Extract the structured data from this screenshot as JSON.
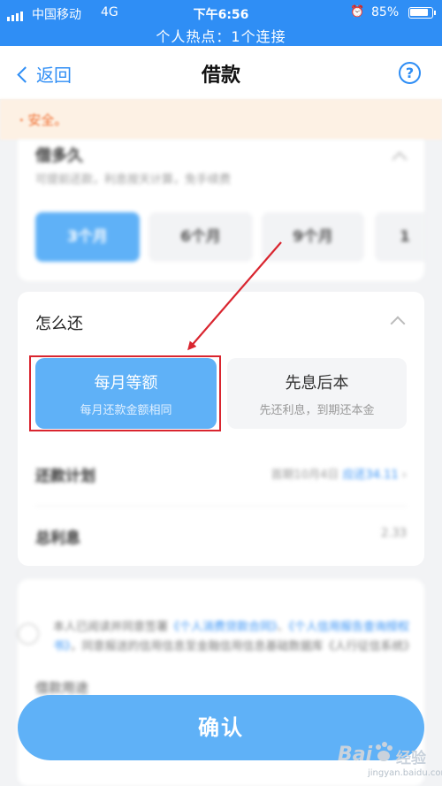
{
  "status_bar": {
    "carrier": "中国移动",
    "network": "4G",
    "time": "下午6:56",
    "battery": "85%",
    "hotspot": "个人热点：1个连接"
  },
  "nav": {
    "back_label": "返回",
    "title": "借款",
    "help_label": "?"
  },
  "notice": {
    "text": "ꞏ 安全。"
  },
  "loan_term": {
    "title": "借多久",
    "subtitle": "可提前还款，利息按天计算，免手续费",
    "options": [
      "3个月",
      "6个月",
      "9个月",
      "1"
    ],
    "selected_index": 0
  },
  "repayment": {
    "title": "怎么还",
    "options": [
      {
        "title": "每月等额",
        "subtitle": "每月还款金额相同"
      },
      {
        "title": "先息后本",
        "subtitle": "先还利息，到期还本金"
      }
    ],
    "selected_index": 0,
    "plan_label": "还款计划",
    "plan_value_prefix": "首期10月4日",
    "plan_value_amount": "应还34.11",
    "interest_label": "总利息",
    "interest_value": "2.33"
  },
  "agreement": {
    "prefix": "本人已阅读并同意签署",
    "link1": "《个人消费贷款合同》",
    "sep": "、",
    "link2": "《个人信用报告查询授权书》",
    "middle": "，同意报送",
    "suffix": "的信用信息至金融信用信息基础数据库",
    "link3": "《人行征信系统》"
  },
  "purpose_label": "借款用途",
  "confirm_label": "确认",
  "watermark": {
    "logo": "Bai",
    "brand": "经验",
    "url": "jingyan.baidu.com"
  },
  "colors": {
    "brand_blue": "#2f8ef5",
    "selected_blue": "#5fb1f7",
    "annotation_red": "#d9252f",
    "notice_orange": "#f06b2c"
  }
}
